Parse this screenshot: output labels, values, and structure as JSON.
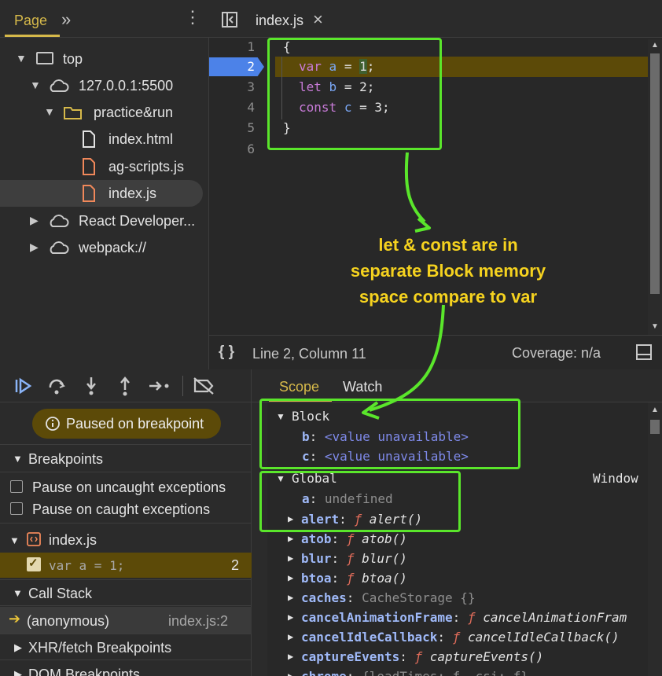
{
  "nav": {
    "tab_label": "Page",
    "tree": [
      {
        "label": "top",
        "icon": "window-icon"
      },
      {
        "label": "127.0.0.1:5500",
        "icon": "cloud-icon"
      },
      {
        "label": "practice&run",
        "icon": "folder-icon"
      },
      {
        "label": "index.html",
        "icon": "file-icon"
      },
      {
        "label": "ag-scripts.js",
        "icon": "js-file-icon"
      },
      {
        "label": "index.js",
        "icon": "js-file-icon"
      },
      {
        "label": "React Developer...",
        "icon": "cloud-icon"
      },
      {
        "label": "webpack://",
        "icon": "cloud-icon"
      }
    ]
  },
  "editor": {
    "tab_label": "index.js",
    "close_glyph": "×",
    "line_numbers": [
      "1",
      "2",
      "3",
      "4",
      "5",
      "6"
    ],
    "code": {
      "l1": "{",
      "l2_kw": "var",
      "l2_name": "a",
      "l2_eq": " = ",
      "l2_val": "1",
      "l2_end": ";",
      "l3_kw": "let",
      "l3_name": "b",
      "l3_rest": " = 2;",
      "l4_kw": "const",
      "l4_name": "c",
      "l4_rest": " = 3;",
      "l5": "}"
    },
    "status": {
      "braces": "{ }",
      "position": "Line 2, Column 11",
      "coverage": "Coverage: n/a"
    }
  },
  "annotation": {
    "line1": "let & const are in",
    "line2": "separate Block memory",
    "line3": "space compare to var",
    "color": "#f5d21f",
    "box_color": "#5ae62b"
  },
  "debugger": {
    "paused_label": "Paused on breakpoint",
    "breakpoints_label": "Breakpoints",
    "uncaught_label": "Pause on uncaught exceptions",
    "caught_label": "Pause on caught exceptions",
    "file_label": "index.js",
    "bp_code": "var a = 1;",
    "bp_line": "2",
    "callstack_label": "Call Stack",
    "frame_name": "(anonymous)",
    "frame_loc": "index.js:2",
    "xhr_label": "XHR/fetch Breakpoints",
    "dom_label": "DOM Breakpoints"
  },
  "scope": {
    "tab_scope": "Scope",
    "tab_watch": "Watch",
    "block_label": "Block",
    "block_items": [
      {
        "name": "b",
        "value": "<value unavailable>"
      },
      {
        "name": "c",
        "value": "<value unavailable>"
      }
    ],
    "global_label": "Global",
    "global_type": "Window",
    "a_name": "a",
    "a_value": "undefined",
    "globals": [
      {
        "name": "alert",
        "f": "ƒ",
        "value": "alert()"
      },
      {
        "name": "atob",
        "f": "ƒ",
        "value": "atob()"
      },
      {
        "name": "blur",
        "f": "ƒ",
        "value": "blur()"
      },
      {
        "name": "btoa",
        "f": "ƒ",
        "value": "btoa()"
      },
      {
        "name": "caches",
        "f": "",
        "value": "CacheStorage {}"
      },
      {
        "name": "cancelAnimationFrame",
        "f": "ƒ",
        "value": "cancelAnimationFram"
      },
      {
        "name": "cancelIdleCallback",
        "f": "ƒ",
        "value": "cancelIdleCallback()"
      },
      {
        "name": "captureEvents",
        "f": "ƒ",
        "value": "captureEvents()"
      },
      {
        "name": "chrome",
        "f": "",
        "value": "{loadTimes: ƒ, csi: ƒ}"
      }
    ]
  }
}
